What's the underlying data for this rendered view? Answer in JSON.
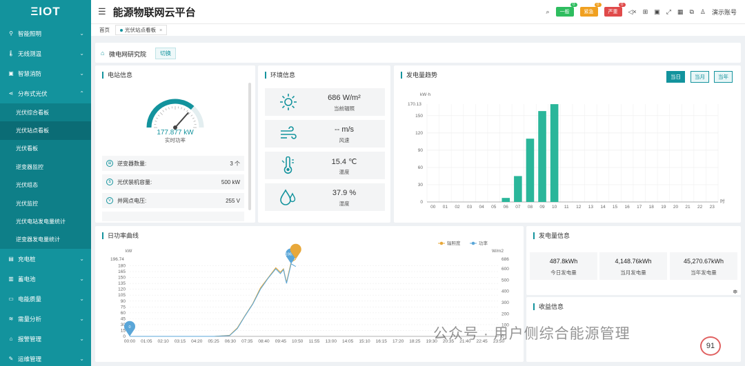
{
  "sidebar": {
    "logo": "ΞIOT",
    "items_before": [
      {
        "label": "智能照明"
      },
      {
        "label": "无线测温"
      },
      {
        "label": "智慧消防"
      }
    ],
    "expanded": {
      "label": "分布式光伏",
      "children": [
        "光伏综合看板",
        "光伏站点看板",
        "光伏看板",
        "逆变器监控",
        "光伏组态",
        "光伏监控",
        "光伏电站发电量统计",
        "逆变器发电量统计"
      ]
    },
    "items_after": [
      {
        "label": "充电桩"
      },
      {
        "label": "蓄电池"
      },
      {
        "label": "电能质量"
      },
      {
        "label": "需量分析"
      },
      {
        "label": "报警管理"
      },
      {
        "label": "运维管理"
      }
    ]
  },
  "header": {
    "title": "能源物联网云平台",
    "alerts": [
      {
        "label": "一般",
        "count": "0",
        "color": "#2ebd5f"
      },
      {
        "label": "紧急",
        "count": "0",
        "color": "#f0a020"
      },
      {
        "label": "严重",
        "count": "0",
        "color": "#e04a4a"
      }
    ],
    "user": "演示账号"
  },
  "tabs": {
    "home": "首页",
    "active": "光伏站点看板",
    "close": "×"
  },
  "org": {
    "name": "微电网研究院",
    "switch_label": "切换"
  },
  "station": {
    "title": "电站信息",
    "gauge_value": "177.877 kW",
    "gauge_level": 0.73,
    "gauge_label": "实时功率",
    "rows": [
      {
        "label": "逆变器数量:",
        "value": "3 个",
        "icon": "inverter-icon"
      },
      {
        "label": "光伏装机容量:",
        "value": "500 kW",
        "icon": "capacity-icon"
      },
      {
        "label": "并网点电压:",
        "value": "255 V",
        "icon": "voltage-icon"
      }
    ]
  },
  "env": {
    "title": "环境信息",
    "items": [
      {
        "value": "686 W/m²",
        "label": "当前辐照",
        "icon": "sun-icon"
      },
      {
        "value": "-- m/s",
        "label": "风速",
        "icon": "wind-icon"
      },
      {
        "value": "15.4 ℃",
        "label": "温度",
        "icon": "thermometer-icon"
      },
      {
        "value": "37.9 %",
        "label": "湿度",
        "icon": "humidity-icon"
      }
    ]
  },
  "generation": {
    "title": "发电量趋势",
    "ranges": [
      "当日",
      "当月",
      "当年"
    ],
    "active_range": "当日"
  },
  "power": {
    "title": "日功率曲线"
  },
  "stats": {
    "title": "发电量信息",
    "items": [
      {
        "value": "487.8kWh",
        "label": "今日发电量"
      },
      {
        "value": "4,148.76kWh",
        "label": "当月发电量"
      },
      {
        "value": "45,270.67kWh",
        "label": "当年发电量"
      }
    ]
  },
  "income": {
    "title": "收益信息"
  },
  "watermark": "公众号 · 用户侧综合能源管理",
  "badge": "91",
  "chart_data": [
    {
      "type": "bar",
      "ylabel": "kW·h",
      "ymax_label": "170.13",
      "xlabel": "时",
      "ylim": [
        0,
        170.13
      ],
      "yticks": [
        0,
        30,
        60,
        90,
        120,
        150
      ],
      "categories": [
        "00",
        "01",
        "02",
        "03",
        "04",
        "05",
        "06",
        "07",
        "08",
        "09",
        "10",
        "11",
        "12",
        "13",
        "14",
        "15",
        "16",
        "17",
        "18",
        "19",
        "20",
        "21",
        "22",
        "23"
      ],
      "values": [
        0,
        0,
        0,
        0,
        0,
        0,
        7,
        45,
        110,
        158,
        170,
        0,
        0,
        0,
        0,
        0,
        0,
        0,
        0,
        0,
        0,
        0,
        0,
        0
      ],
      "color": "#2ab69a"
    },
    {
      "type": "line",
      "ylabel_left": "kW",
      "ylabel_right": "W/m2",
      "ymax_label": "196.74",
      "yticks_left": [
        0,
        15,
        30,
        45,
        60,
        75,
        90,
        105,
        120,
        135,
        150,
        165,
        180
      ],
      "yticks_right": [
        0,
        100,
        200,
        300,
        400,
        500,
        600,
        686
      ],
      "ylim_left": [
        0,
        196.74
      ],
      "ylim_right": [
        0,
        686
      ],
      "x_labels": [
        "00:00",
        "01:05",
        "02:10",
        "03:15",
        "04:20",
        "05:25",
        "06:30",
        "07:35",
        "08:40",
        "09:45",
        "10:50",
        "11:55",
        "13:00",
        "14:05",
        "15:10",
        "16:15",
        "17:20",
        "18:25",
        "19:30",
        "20:35",
        "21:40",
        "22:45",
        "23:50"
      ],
      "series": [
        {
          "name": "辐照度",
          "color": "#e8a83a",
          "axis": "right",
          "x": [
            0,
            5.5,
            6.5,
            7,
            7.5,
            8,
            8.5,
            9,
            9.5,
            9.8,
            10,
            10.2,
            10.5,
            10.8
          ],
          "y": [
            0,
            0,
            10,
            75,
            185,
            290,
            430,
            520,
            610,
            570,
            600,
            480,
            660,
            686
          ]
        },
        {
          "name": "功率",
          "color": "#5aa6d8",
          "axis": "left",
          "x": [
            0,
            5.5,
            6.5,
            7,
            7.5,
            8,
            8.5,
            9,
            9.5,
            9.8,
            10,
            10.2,
            10.5,
            10.8
          ],
          "y": [
            0,
            0,
            2,
            20,
            52,
            82,
            120,
            148,
            172,
            160,
            170,
            135,
            185,
            178
          ]
        }
      ],
      "markers": [
        {
          "label": "0",
          "x": 0,
          "series": "功率"
        },
        {
          "label": "196.74",
          "x": 10.5,
          "series": "功率"
        }
      ]
    }
  ]
}
